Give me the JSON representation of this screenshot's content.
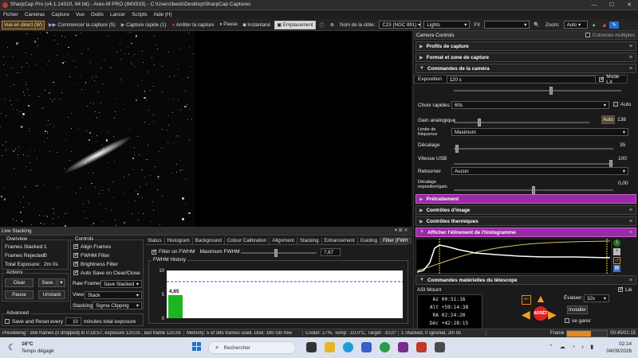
{
  "window": {
    "title": "SharpCap Pro (v4.1.14310, 64 bit) - Ares-M PRO (IMX533) - C:\\Users\\beck\\Desktop\\SharpCap Captures",
    "controls": [
      "—",
      "☐",
      "✕"
    ]
  },
  "menu": [
    "Fichier",
    "Caméras",
    "Capture",
    "Vue",
    "Outils",
    "Lancer",
    "Scripts",
    "Aide (H)"
  ],
  "toolbar": {
    "live": "Vue en direct (W)",
    "start_capture": "Commencer la capture (S)",
    "quick_capture": "Capture rapide (1)",
    "stop_capture": "Arrêter la capture",
    "pause": "Pause",
    "snapshot": "Instantané",
    "placement": "Emplacement",
    "target_label": "Nom de la cible:",
    "target_value": "C23 (NGC 891)",
    "frame_type": "Lights",
    "fx_label": "FX",
    "zoom_label": "Zoom:",
    "zoom_value": "Auto"
  },
  "right_panel": {
    "title": "Camera Controls",
    "multi_columns": "Colonnes multiples",
    "sections": {
      "profiles": "Profils de capture",
      "format": "Format et zone de capture",
      "camera": "Commandes de la caméra",
      "processing": "Prétraitement",
      "image": "Contrôles d'image",
      "thermal": "Contrôles thermiques",
      "histogram": "Afficher l'étirement de l'histogramme",
      "telescope": "Commandes matérielles du télescope"
    },
    "exposure": {
      "label": "Exposition",
      "value": "120 s",
      "mode_lx": "Mode LX"
    },
    "quick_choice": {
      "label": "Choix rapides",
      "value": "60s",
      "auto": "Auto"
    },
    "gain": {
      "label": "Gain analogique",
      "auto": "Auto",
      "value": "138"
    },
    "freq": {
      "label": "Limite de fréquence d'images",
      "value": "Maximum"
    },
    "offset": {
      "label": "Décalage",
      "value": "35"
    },
    "usb": {
      "label": "Vitesse USB",
      "value": "100"
    },
    "flip": {
      "label": "Retourner",
      "value": "Aucun"
    },
    "exp_gain_offset": {
      "label": "Décalage exposition/gain",
      "value": "0,00"
    },
    "mount": {
      "name": "ASI Mount",
      "lie": "Lié",
      "az_l": "Az",
      "az": "00:51:16",
      "alt_l": "Alt",
      "alt": "+59:14:38",
      "ra_l": "RA",
      "ra": "02:24:20",
      "dec_l": "Déc",
      "dec": "+42:28:15",
      "evaluer": "Évaluer:",
      "rate": "32x",
      "install": "Installer",
      "park": "se garer",
      "stop": "ARRÊT"
    }
  },
  "live_stack": {
    "title": "Live Stacking",
    "overview": {
      "title": "Overview",
      "frames_stacked_l": "Frames Stacked:",
      "frames_stacked": "1",
      "frames_rejected_l": "Frames Rejected:",
      "frames_rejected": "0",
      "total_exposure_l": "Total Exposure:",
      "total_exposure": "2m 0s"
    },
    "actions": {
      "title": "Actions",
      "clear": "Clear",
      "save": "Save",
      "pause": "Pause",
      "unstack": "Unstack"
    },
    "advanced": {
      "title": "Advanced",
      "save_reset": "Save and Reset every",
      "minutes": "10",
      "suffix": "minutes total exposure"
    },
    "controls": {
      "title": "Controls",
      "align": "Align Frames",
      "fwhm": "FWHM Filter",
      "brightness": "Brightness Filter",
      "autosave": "Auto Save on Clear/Close",
      "raw_frames_l": "Raw Frames",
      "raw_frames": "Save Stacked",
      "view_l": "View",
      "view": "Stack",
      "stacking_l": "Stacking",
      "stacking": "Sigma Clipping"
    },
    "tabs": [
      "Status",
      "Histogram",
      "Background",
      "Colour Calibration",
      "Alignment",
      "Stacking",
      "Enhancement",
      "Guiding",
      "Filter (FWH"
    ],
    "filter_on": "Filter on FWHM",
    "max_fwhm_l": "Maximum FWHM",
    "max_fwhm": "7,67",
    "history_title": "FWHM History",
    "y_ticks": [
      "10",
      "5",
      "0"
    ],
    "chart_data": {
      "type": "bar",
      "values": [
        4.85
      ],
      "data_labels": [
        "4,85"
      ],
      "ylim": [
        0,
        10
      ],
      "threshold": 7.67
    }
  },
  "statusbar": {
    "preview": "Previewing : 356 frames (0 dropped) in 0:18:57, exposure 120,0s , last frame 120,0s",
    "memory": "Memory: 5 of 385 frames used, Disk: 180 GB free",
    "cooler": "Cooler: 27%, Temp: -10,0°C, Target: -10,0°",
    "stacked": "1 Stacked, 0 Ignored, 2m 0s",
    "frame_l": "Frame",
    "timer": "00:45/01:15"
  },
  "taskbar": {
    "temp": "16°C",
    "weather": "Temps dégagé",
    "search": "Rechercher",
    "time": "02:14",
    "date": "04/09/2026"
  },
  "colors": {
    "accent": "#c98a2a",
    "purple": "#9b2aa6",
    "bar": "#1fb51f",
    "threshold": "#3a45d8"
  }
}
